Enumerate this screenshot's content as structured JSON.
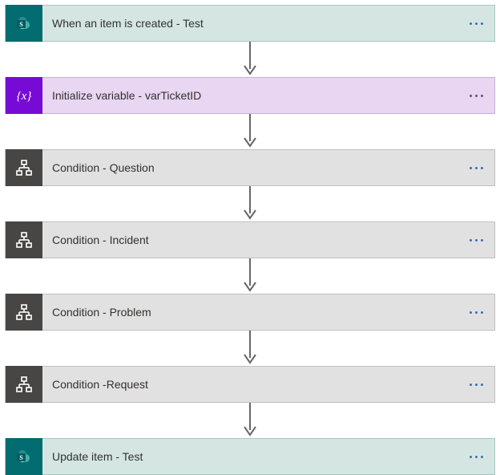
{
  "flow": {
    "steps": [
      {
        "label": "When an item is created - Test",
        "type": "trigger",
        "icon": "sharepoint"
      },
      {
        "label": "Initialize variable - varTicketID",
        "type": "variable",
        "icon": "variable"
      },
      {
        "label": "Condition - Question",
        "type": "condition",
        "icon": "condition"
      },
      {
        "label": "Condition - Incident",
        "type": "condition",
        "icon": "condition"
      },
      {
        "label": "Condition - Problem",
        "type": "condition",
        "icon": "condition"
      },
      {
        "label": "Condition -Request",
        "type": "condition",
        "icon": "condition"
      },
      {
        "label": "Update item - Test",
        "type": "action",
        "icon": "sharepoint"
      }
    ]
  },
  "colors": {
    "sharepoint_bg": "#036c70",
    "variable_bg": "#770bd6",
    "condition_bg": "#484644",
    "trigger_card": "#d5e6e2",
    "variable_card": "#e8d6f2",
    "condition_card": "#e2e1e1"
  }
}
